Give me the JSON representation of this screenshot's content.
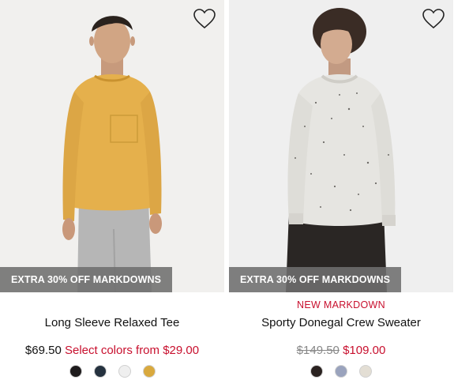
{
  "products": [
    {
      "promo": "EXTRA 30% OFF MARKDOWNS",
      "name": "Long Sleeve Relaxed Tee",
      "price": "$69.50",
      "sale_text": "Select colors from $29.00",
      "swatches": [
        {
          "color": "#1e1b1c"
        },
        {
          "color": "#25323f"
        },
        {
          "color": "#efefef"
        },
        {
          "color": "#d9a93e"
        }
      ]
    },
    {
      "badge": "NEW MARKDOWN",
      "promo": "EXTRA 30% OFF MARKDOWNS",
      "name": "Sporty Donegal Crew Sweater",
      "original_price": "$149.50",
      "sale_price": "$109.00",
      "swatches": [
        {
          "color": "#2a2220"
        },
        {
          "color": "#9aa3bd"
        },
        {
          "color": "#e3ded4"
        }
      ]
    }
  ],
  "icons": {
    "wishlist": "heart-outline-icon"
  }
}
